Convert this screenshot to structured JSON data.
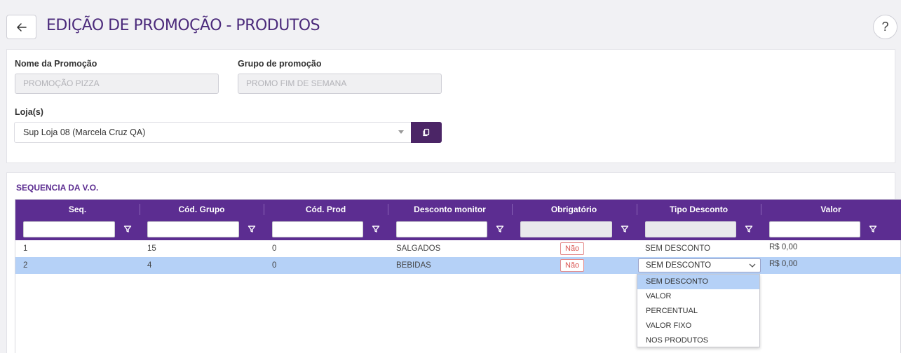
{
  "header": {
    "title": "EDIÇÃO DE PROMOÇÃO - PRODUTOS",
    "back_icon": "arrow-left-icon",
    "help_label": "?"
  },
  "form": {
    "nome_promocao": {
      "label": "Nome da Promoção",
      "value": "PROMOÇÃO PIZZA"
    },
    "grupo_promocao": {
      "label": "Grupo de promoção",
      "value": "PROMO FIM DE SEMANA"
    },
    "lojas": {
      "label": "Loja(s)",
      "value": "Sup Loja 08 (Marcela Cruz QA)",
      "copy_icon": "copy-icon"
    }
  },
  "grid": {
    "title": "SEQUENCIA DA V.O.",
    "columns": [
      "Seq.",
      "Cód. Grupo",
      "Cód. Prod",
      "Desconto monitor",
      "Obrigatório",
      "Tipo Desconto",
      "Valor"
    ],
    "rows": [
      {
        "seq": "1",
        "cod_grupo": "15",
        "cod_prod": "0",
        "desconto_monitor": "SALGADOS",
        "obrigatorio": "Não",
        "tipo_desconto": "SEM DESCONTO",
        "valor": "R$ 0,00",
        "selected": false
      },
      {
        "seq": "2",
        "cod_grupo": "4",
        "cod_prod": "0",
        "desconto_monitor": "BEBIDAS",
        "obrigatorio": "Não",
        "tipo_desconto": "SEM DESCONTO",
        "valor": "R$ 0,00",
        "selected": true
      }
    ],
    "tipo_desconto_options": [
      "SEM DESCONTO",
      "VALOR",
      "PERCENTUAL",
      "VALOR FIXO",
      "NOS PRODUTOS"
    ]
  },
  "colors": {
    "brand_purple": "#5c2d91",
    "title_purple": "#4b2a7b",
    "selected_row": "#b5d1f7",
    "badge_red": "#d9534f"
  }
}
